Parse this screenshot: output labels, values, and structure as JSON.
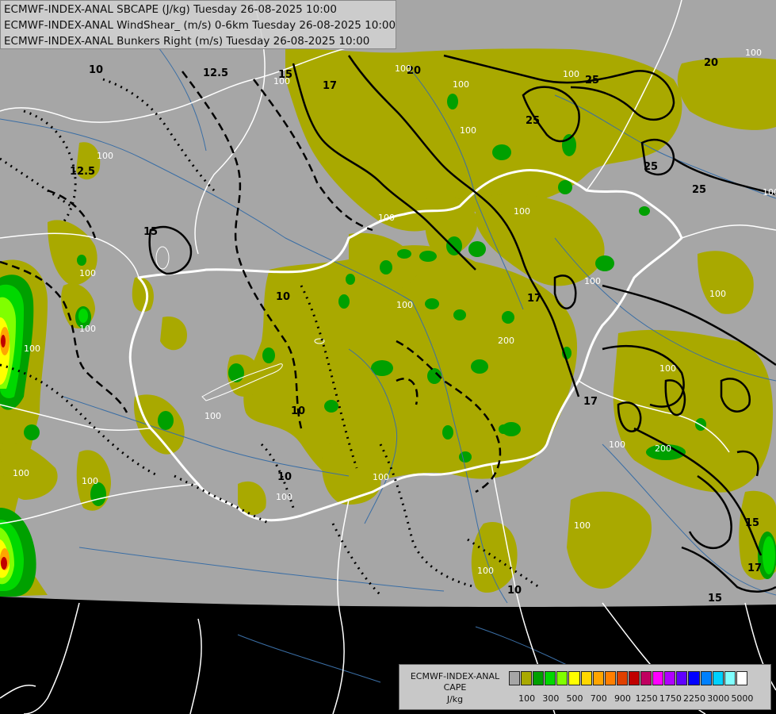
{
  "header": {
    "line1": "ECMWF-INDEX-ANAL SBCAPE (J/kg) Tuesday 26-08-2025 10:00",
    "line2": "ECMWF-INDEX-ANAL WindShear_ (m/s) 0-6km Tuesday 26-08-2025 10:00",
    "line3": "ECMWF-INDEX-ANAL Bunkers Right (m/s) Tuesday 26-08-2025 10:00"
  },
  "legend": {
    "line1": "ECMWF-INDEX-ANAL",
    "line2": "CAPE",
    "line3": "J/kg",
    "colors": [
      "#a6a6a6",
      "#a9a900",
      "#00a000",
      "#00d800",
      "#80ff00",
      "#ffff00",
      "#ffd700",
      "#ffa500",
      "#ff7f00",
      "#e04000",
      "#c00000",
      "#c00060",
      "#ff00ff",
      "#b000ff",
      "#6000ff",
      "#0000ff",
      "#0080ff",
      "#00d0ff",
      "#80ffff",
      "#ffffff"
    ],
    "ticks": [
      "100",
      "300",
      "500",
      "700",
      "900",
      "1250",
      "1750",
      "2250",
      "3000",
      "5000"
    ]
  },
  "map": {
    "colors": {
      "background": "#000000",
      "no_data": "#a6a6a6",
      "cape_100": "#a9a900",
      "cape_300": "#00a000",
      "cape_500": "#00d800",
      "cape_700": "#80ff00",
      "cape_900": "#ffff00",
      "cape_1250": "#ffa500",
      "cape_1750": "#c00000",
      "country_borders": "#ffffff",
      "rivers": "#3a6ea5",
      "contours": "#000000"
    },
    "contour_labels": {
      "wind_shear": [
        "12.5",
        "10",
        "12.5",
        "10",
        "10",
        "10",
        "10",
        "10",
        "15",
        "17",
        "17",
        "17",
        "25",
        "25",
        "25",
        "20",
        "20",
        "15",
        "15",
        "17",
        "10"
      ],
      "cape": [
        "100",
        "100",
        "100",
        "100",
        "100",
        "100",
        "100",
        "100",
        "100",
        "100",
        "200",
        "100",
        "100",
        "200",
        "100",
        "100",
        "100",
        "100",
        "100",
        "100",
        "100",
        "200",
        "100",
        "100",
        "100",
        "100",
        "100"
      ]
    }
  }
}
